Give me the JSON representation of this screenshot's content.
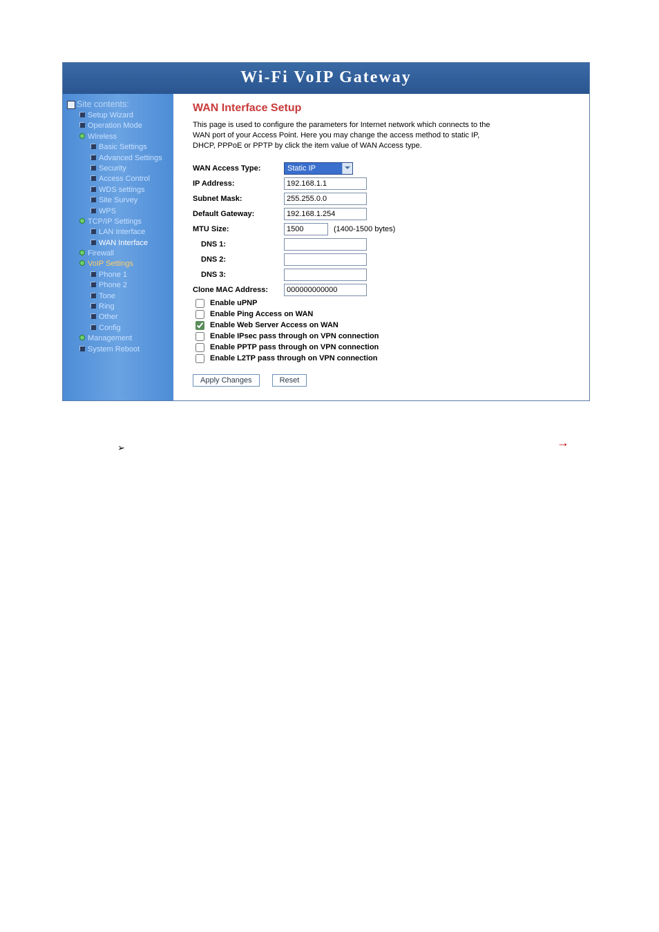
{
  "header": {
    "title": "Wi-Fi  VoIP  Gateway"
  },
  "sidebar": {
    "title": "Site contents:",
    "items": [
      {
        "type": "page",
        "label": "Setup Wizard",
        "lvl": 1
      },
      {
        "type": "page",
        "label": "Operation Mode",
        "lvl": 1
      },
      {
        "type": "folder",
        "label": "Wireless",
        "lvl": 1
      },
      {
        "type": "page",
        "label": "Basic Settings",
        "lvl": 2
      },
      {
        "type": "page",
        "label": "Advanced Settings",
        "lvl": 2
      },
      {
        "type": "page",
        "label": "Security",
        "lvl": 2
      },
      {
        "type": "page",
        "label": "Access Control",
        "lvl": 2
      },
      {
        "type": "page",
        "label": "WDS settings",
        "lvl": 2
      },
      {
        "type": "page",
        "label": "Site Survey",
        "lvl": 2
      },
      {
        "type": "page",
        "label": "WPS",
        "lvl": 2
      },
      {
        "type": "folder",
        "label": "TCP/IP Settings",
        "lvl": 1
      },
      {
        "type": "page",
        "label": "LAN Interface",
        "lvl": 2
      },
      {
        "type": "page",
        "label": "WAN Interface",
        "lvl": 2,
        "active": true
      },
      {
        "type": "folder",
        "label": "Firewall",
        "lvl": 1
      },
      {
        "type": "folder",
        "label": "VoIP Settings",
        "lvl": 1,
        "orange": true
      },
      {
        "type": "page",
        "label": "Phone 1",
        "lvl": 2
      },
      {
        "type": "page",
        "label": "Phone 2",
        "lvl": 2
      },
      {
        "type": "page",
        "label": "Tone",
        "lvl": 2
      },
      {
        "type": "page",
        "label": "Ring",
        "lvl": 2
      },
      {
        "type": "page",
        "label": "Other",
        "lvl": 2
      },
      {
        "type": "page",
        "label": "Config",
        "lvl": 2
      },
      {
        "type": "folder",
        "label": "Management",
        "lvl": 1
      },
      {
        "type": "page",
        "label": "System Reboot",
        "lvl": 1
      }
    ]
  },
  "main": {
    "heading": "WAN Interface Setup",
    "intro": "This page is used to configure the parameters for Internet network which connects to the WAN port of your Access Point. Here you may change the access method to static IP, DHCP, PPPoE or PPTP by click the item value of WAN Access type.",
    "fields": {
      "access_type_label": "WAN Access Type:",
      "access_type_value": "Static IP",
      "ip_label": "IP Address:",
      "ip_value": "192.168.1.1",
      "mask_label": "Subnet Mask:",
      "mask_value": "255.255.0.0",
      "gw_label": "Default Gateway:",
      "gw_value": "192.168.1.254",
      "mtu_label": "MTU Size:",
      "mtu_value": "1500",
      "mtu_hint": "(1400-1500 bytes)",
      "dns1_label": "DNS 1:",
      "dns1_value": "",
      "dns2_label": "DNS 2:",
      "dns2_value": "",
      "dns3_label": "DNS 3:",
      "dns3_value": "",
      "clonemac_label": "Clone MAC Address:",
      "clonemac_value": "000000000000"
    },
    "checkboxes": [
      {
        "label": "Enable uPNP",
        "checked": false
      },
      {
        "label": "Enable Ping Access on WAN",
        "checked": false
      },
      {
        "label": "Enable Web Server Access on WAN",
        "checked": true
      },
      {
        "label": "Enable IPsec pass through on VPN connection",
        "checked": false
      },
      {
        "label": "Enable PPTP pass through on VPN connection",
        "checked": false
      },
      {
        "label": "Enable L2TP pass through on VPN connection",
        "checked": false
      }
    ],
    "buttons": {
      "apply": "Apply Changes",
      "reset": "Reset"
    }
  },
  "footer": {
    "bullet": "➢",
    "arrow": "→"
  }
}
